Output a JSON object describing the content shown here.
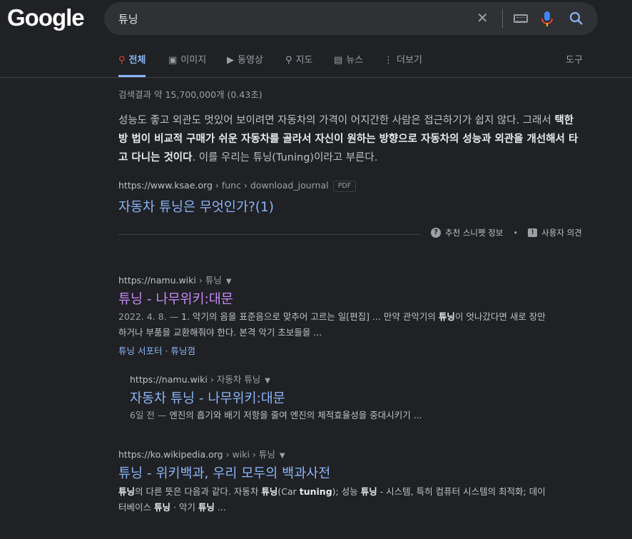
{
  "header": {
    "logo": "Google",
    "query": "튜닝",
    "clear_icon": "close-icon",
    "keyboard_icon": "keyboard-icon",
    "mic_icon": "mic-icon",
    "search_icon": "search-icon"
  },
  "tabs": [
    {
      "label": "전체",
      "icon": "search-icon",
      "glyph": "🔍"
    },
    {
      "label": "이미지",
      "icon": "image-icon",
      "glyph": "▣"
    },
    {
      "label": "동영상",
      "icon": "video-icon",
      "glyph": "▶"
    },
    {
      "label": "지도",
      "icon": "map-pin-icon",
      "glyph": "⚲"
    },
    {
      "label": "뉴스",
      "icon": "news-icon",
      "glyph": "▤"
    },
    {
      "label": "더보기",
      "icon": "more-vert-icon",
      "glyph": "⋮"
    }
  ],
  "tools_label": "도구",
  "stats": "검색결과 약 15,700,000개 (0.43초)",
  "featured": {
    "text_1": "성능도 좋고 외관도 멋있어 보이려면 자동차의 가격이 어지간한 사람은 접근하기가 쉽지 않다. 그래서 ",
    "bold": "택한 방 법이 비교적 구매가 쉬운 자동차를 골라서 자신이 원하는 방향으로 자동차의 성능과 외관을 개선해서 타고 다니는 것이다",
    "text_2": ". 이를 우리는 튜닝(Tuning)이라고 부른다.",
    "cite_domain": "https://www.ksae.org",
    "cite_path": " › func › download_journal",
    "badge": "PDF",
    "title": "자동차 튜닝은 무엇인가?(1)",
    "about_label": "추천 스니펫 정보",
    "feedback_label": "사용자 의견"
  },
  "results": [
    {
      "domain": "https://namu.wiki",
      "path": " › 튜닝",
      "title": "튜닝 - 나무위키:대문",
      "date": "2022. 4. 8. — ",
      "desc_1": "1. 악기의 음을 표준음으로 맞추어 고르는 일[편집] ... 만약 관악기의 ",
      "desc_b1": "튜닝",
      "desc_2": "이 엇나갔다면 새로 장만하거나 부품을 교환해줘야 한다. 본격 악기 초보들을 ...",
      "sublinks": [
        "튜닝 서포터",
        "튜닝껌"
      ]
    },
    {
      "domain": "https://namu.wiki",
      "path": " › 자동차 튜닝",
      "title": "자동차 튜닝 - 나무위키:대문",
      "date": "6일 전 — ",
      "desc": "엔진의 흡기와 배기 저항을 줄여 엔진의 체적효율성을 중대시키기 ..."
    },
    {
      "domain": "https://ko.wikipedia.org",
      "path": " › wiki › 튜닝",
      "title": "튜닝 - 위키백과, 우리 모두의 백과사전",
      "b1": "튜닝",
      "t1": "의 다른 뜻은 다음과 같다. 자동차 ",
      "b2": "튜닝",
      "t2": "(Car ",
      "b3": "tuning",
      "t3": "); 성능 ",
      "b4": "튜닝",
      "t4": " - 시스템, 특히 컴퓨터 시스템의 최적화; 데이터베이스 ",
      "b5": "튜닝",
      "t5": " · 악기 ",
      "b6": "튜닝",
      "t6": " ..."
    }
  ],
  "colors": {
    "background": "#202124",
    "link": "#8ab4f8",
    "visited_link": "#c58af9",
    "text": "#bdc1c6"
  }
}
